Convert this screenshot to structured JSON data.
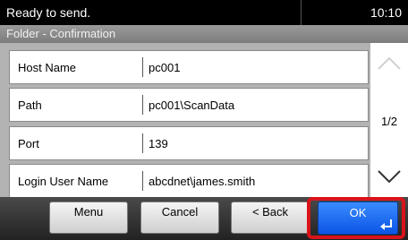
{
  "status": {
    "message": "Ready to send.",
    "time": "10:10"
  },
  "title": "Folder - Confirmation",
  "rows": [
    {
      "label": "Host Name",
      "value": "pc001"
    },
    {
      "label": "Path",
      "value": "pc001\\ScanData"
    },
    {
      "label": "Port",
      "value": "139"
    },
    {
      "label": "Login User Name",
      "value": "abcdnet\\james.smith"
    }
  ],
  "scroll": {
    "page_indicator": "1/2",
    "up_icon": "chevron-up-icon",
    "down_icon": "chevron-down-icon"
  },
  "buttons": {
    "menu": "Menu",
    "cancel": "Cancel",
    "back": "< Back",
    "ok": "OK"
  },
  "colors": {
    "ok_button": "#1a66f2",
    "highlight_frame": "#d8141b"
  }
}
